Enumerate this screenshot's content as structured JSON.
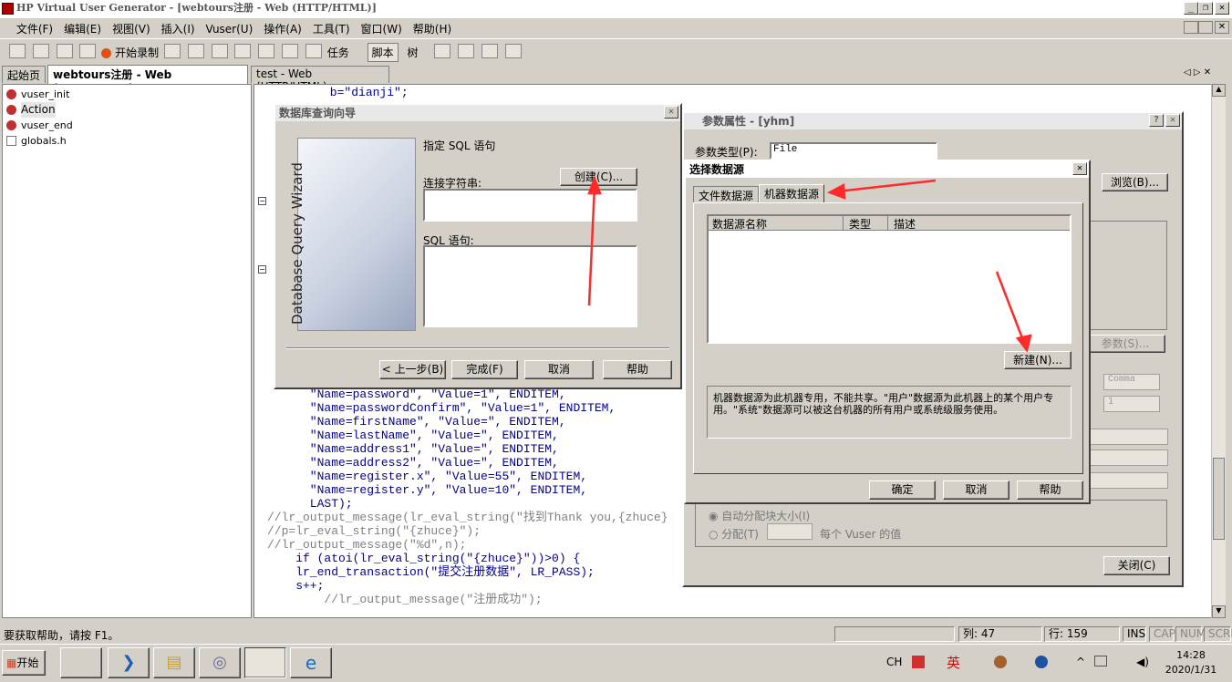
{
  "window": {
    "title": "HP Virtual User Generator - [webtours注册 - Web (HTTP/HTML)]"
  },
  "menu": [
    "文件(F)",
    "编辑(E)",
    "视图(V)",
    "插入(I)",
    "Vuser(U)",
    "操作(A)",
    "工具(T)",
    "窗口(W)",
    "帮助(H)"
  ],
  "toolbar": {
    "record": "开始录制",
    "tasks": "任务",
    "script": "脚本",
    "tree": "树"
  },
  "tabs": [
    "起始页",
    "webtours注册 - Web (HTTP/HTML)",
    "test - Web (HTTP/HTML)"
  ],
  "tree": [
    "vuser_init",
    "Action",
    "vuser_end",
    "globals.h"
  ],
  "code": {
    "top": "      b=\"dianji\";",
    "lines": [
      "      \"Name=password\", \"Value=1\", ENDITEM,",
      "      \"Name=passwordConfirm\", \"Value=1\", ENDITEM,",
      "      \"Name=firstName\", \"Value=\", ENDITEM,",
      "      \"Name=lastName\", \"Value=\", ENDITEM,",
      "      \"Name=address1\", \"Value=\", ENDITEM,",
      "      \"Name=address2\", \"Value=\", ENDITEM,",
      "      \"Name=register.x\", \"Value=55\", ENDITEM,",
      "      \"Name=register.y\", \"Value=10\", ENDITEM,",
      "      LAST);",
      "",
      "//lr_output_message(lr_eval_string(\"找到Thank you,{zhuce}",
      "//p=lr_eval_string(\"{zhuce}\");",
      "//lr_output_message(\"%d\",n);",
      "    if (atoi(lr_eval_string(\"{zhuce}\"))>0) {",
      "    lr_end_transaction(\"提交注册数据\", LR_PASS);",
      "    s++;",
      "        //lr_output_message(\"注册成功\");"
    ]
  },
  "dbwizard": {
    "title": "数据库查询向导",
    "side_text": "Database Query Wizard",
    "heading": "指定 SQL 语句",
    "conn_label": "连接字符串:",
    "create_btn": "创建(C)...",
    "sql_label": "SQL 语句:",
    "back": "< 上一步(B)",
    "finish": "完成(F)",
    "cancel": "取消",
    "help": "帮助"
  },
  "paramprops": {
    "title": "参数属性 - [yhm]",
    "type_label": "参数类型(P):",
    "type_value": "File",
    "browse": "浏览(B)...",
    "param_btn": "参数(S)...",
    "comma": "Comma",
    "one": "1",
    "auto_alloc": "自动分配块大小(I)",
    "alloc": "分配(T)",
    "per_vuser": "每个 Vuser 的值",
    "close": "关闭(C)"
  },
  "dsn": {
    "title": "选择数据源",
    "tab_file": "文件数据源",
    "tab_machine": "机器数据源",
    "col_name": "数据源名称",
    "col_type": "类型",
    "col_desc": "描述",
    "new_btn": "新建(N)...",
    "desc": "机器数据源为此机器专用，不能共享。\"用户\"数据源为此机器上的某个用户专用。\"系统\"数据源可以被这台机器的所有用户或系统级服务使用。",
    "ok": "确定",
    "cancel": "取消",
    "help": "帮助"
  },
  "status": {
    "hint": "要获取帮助，请按 F1。",
    "col": "列: 47",
    "row": "行: 159",
    "ins": "INS",
    "cap": "CAP",
    "num": "NUM",
    "scrl": "SCRL"
  },
  "taskbar": {
    "start": "开始",
    "lang": "CH",
    "ime": "英",
    "time": "14:28",
    "date": "2020/1/31"
  }
}
